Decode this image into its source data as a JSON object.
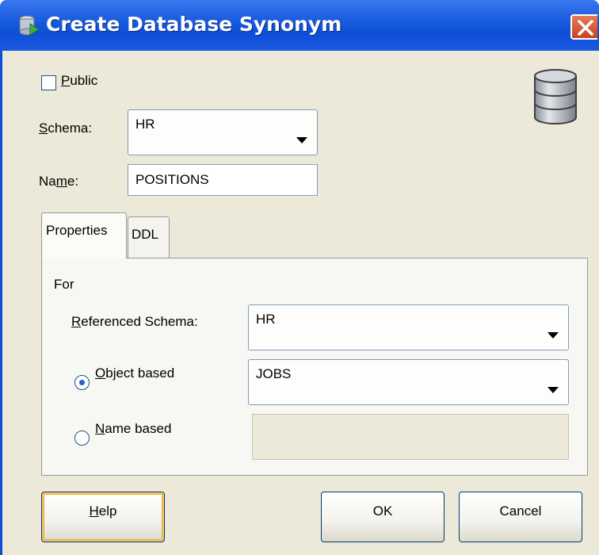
{
  "window": {
    "title": "Create Database Synonym"
  },
  "public_checkbox": {
    "label_accel": "P",
    "label_rest": "ublic",
    "checked": false
  },
  "schema": {
    "label_accel": "S",
    "label_rest": "chema:",
    "value": "HR"
  },
  "name": {
    "label_pre": "Na",
    "label_accel": "m",
    "label_rest": "e:",
    "value": "POSITIONS"
  },
  "tabs": [
    {
      "label": "Properties"
    },
    {
      "label": "DDL"
    }
  ],
  "properties": {
    "for_label": "For",
    "referenced_schema": {
      "label_accel": "R",
      "label_rest": "eferenced Schema:",
      "value": "HR"
    },
    "object_based": {
      "label_accel": "O",
      "label_rest": "bject based",
      "value": "JOBS",
      "selected": true
    },
    "name_based": {
      "label_accel": "N",
      "label_rest": "ame based",
      "value": "",
      "selected": false
    }
  },
  "buttons": {
    "help": {
      "label_accel": "H",
      "label_rest": "elp"
    },
    "ok": {
      "label": "OK"
    },
    "cancel": {
      "label": "Cancel"
    }
  },
  "colors": {
    "titlebar": "#0b4fd6",
    "dialog_bg": "#ece9d8",
    "close": "#c8431e"
  },
  "icons": {
    "title": "synonym-icon",
    "header": "database-icon",
    "close": "close-icon"
  }
}
